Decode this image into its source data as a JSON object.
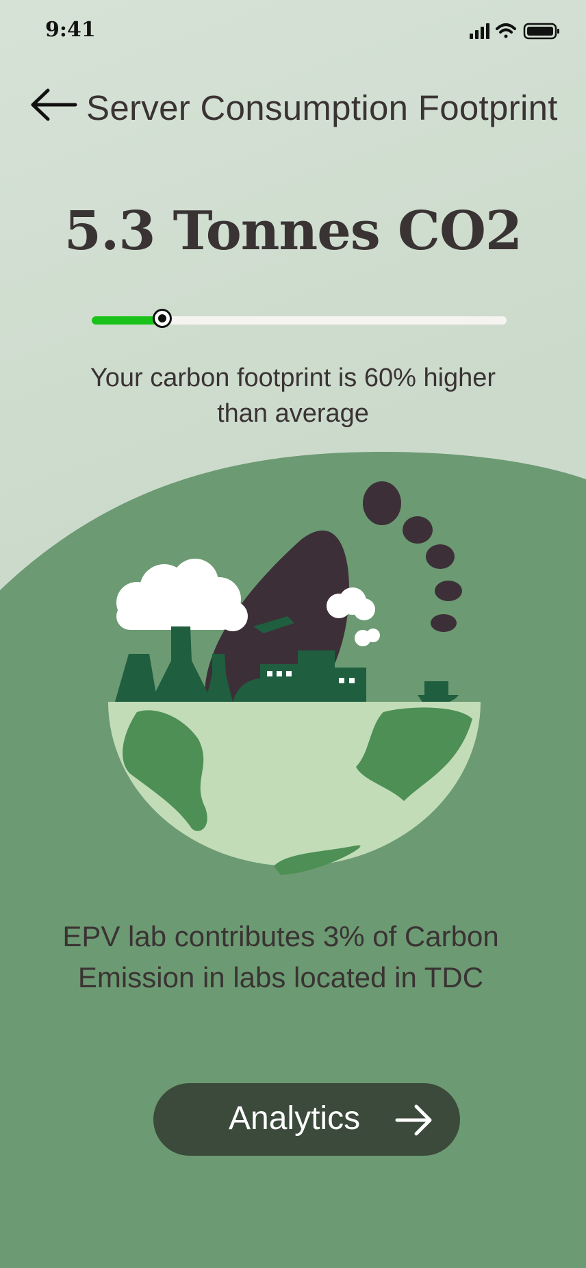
{
  "status_bar": {
    "time": "9:41"
  },
  "header": {
    "title": "Server Consumption Footprint",
    "back_icon": "arrow-left-icon"
  },
  "summary": {
    "headline": "5.3 Tonnes CO2",
    "slider_fraction": 0.17,
    "slider_fill_color": "#19c219",
    "description": "Your carbon footprint is 60% higher than average"
  },
  "illustration": {
    "icon": "globe-footprint-pollution-illustration"
  },
  "info": {
    "text": "EPV lab contributes 3% of Carbon Emission in labs located in TDC"
  },
  "cta": {
    "label": "Analytics",
    "icon": "arrow-right-icon"
  },
  "colors": {
    "background": "#d0ddd0",
    "panel": "#6c9a73",
    "button": "#3b4a3a",
    "text": "#3a3333"
  }
}
